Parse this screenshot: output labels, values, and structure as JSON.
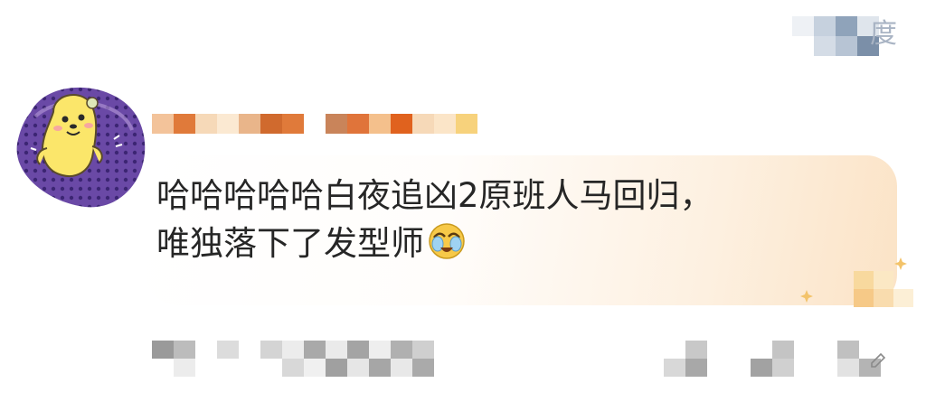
{
  "header": {
    "top_right_label": "度"
  },
  "comment": {
    "author_avatar_icon": "yellow-seal-sticker-avatar",
    "text_line_1": "哈哈哈哈哈白夜追凶2原班人马回归，",
    "text_line_2": "唯独落下了发型师",
    "emoji_icon": "crying-laughing-face",
    "bubble_color": "#fbe3c6"
  },
  "footer": {
    "reply_icon": "reply-icon"
  }
}
